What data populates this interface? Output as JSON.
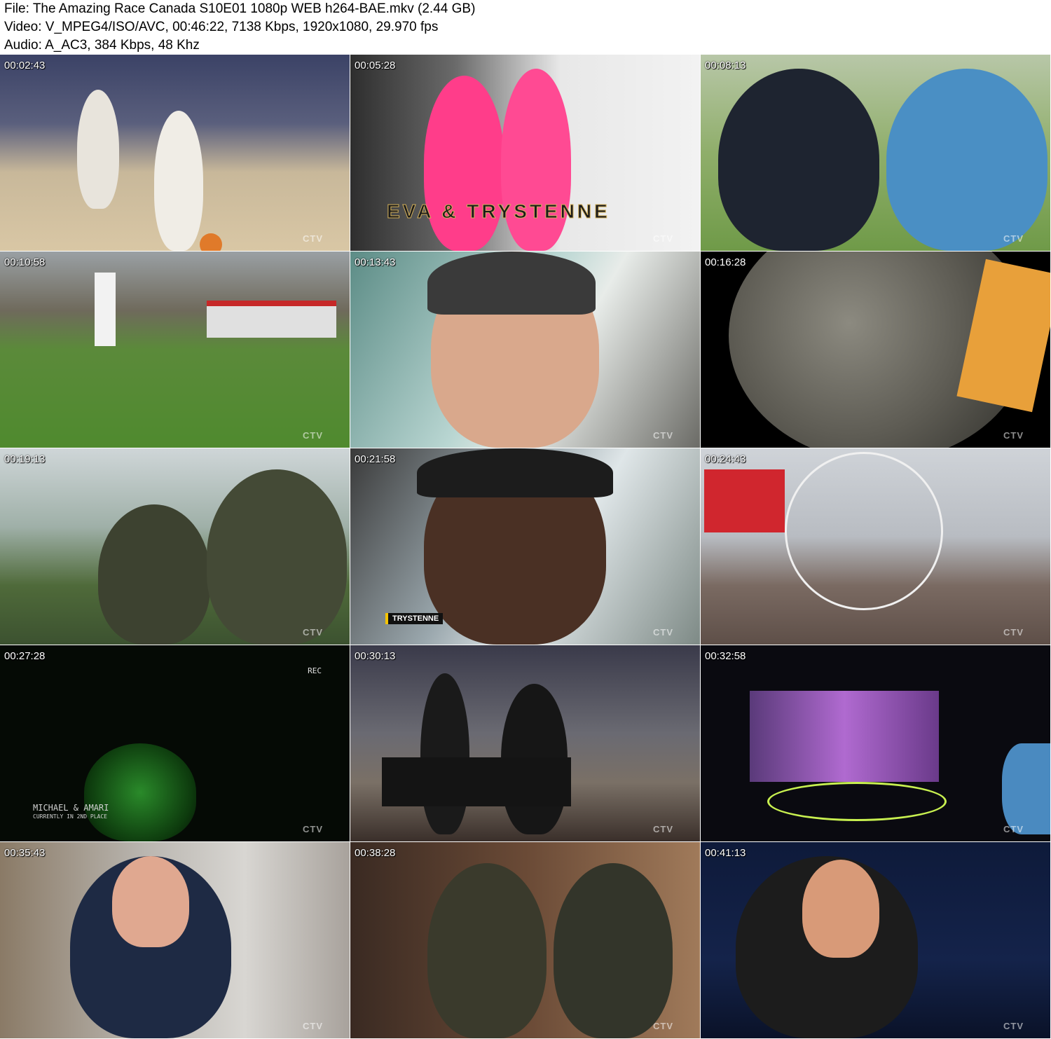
{
  "header": {
    "file": "File: The Amazing Race Canada S10E01 1080p WEB h264-BAE.mkv (2.44 GB)",
    "video": "Video: V_MPEG4/ISO/AVC, 00:46:22, 7138 Kbps, 1920x1080, 29.970 fps",
    "audio": "Audio: A_AC3, 384 Kbps, 48 Khz"
  },
  "thumbnails": [
    {
      "timestamp": "00:02:43",
      "watermark": "CTV"
    },
    {
      "timestamp": "00:05:28",
      "watermark": "CTV",
      "caption": "EVA & TRYSTENNE"
    },
    {
      "timestamp": "00:08:13",
      "watermark": "CTV"
    },
    {
      "timestamp": "00:10:58",
      "watermark": "CTV"
    },
    {
      "timestamp": "00:13:43",
      "watermark": "CTV"
    },
    {
      "timestamp": "00:16:28",
      "watermark": "CTV"
    },
    {
      "timestamp": "00:19:13",
      "watermark": "CTV"
    },
    {
      "timestamp": "00:21:58",
      "watermark": "CTV",
      "caption": "TRYSTENNE"
    },
    {
      "timestamp": "00:24:43",
      "watermark": "CTV"
    },
    {
      "timestamp": "00:27:28",
      "watermark": "CTV",
      "caption": "MICHAEL & AMARI",
      "subcaption": "CURRENTLY IN 2ND PLACE",
      "rec": "REC"
    },
    {
      "timestamp": "00:30:13",
      "watermark": "CTV"
    },
    {
      "timestamp": "00:32:58",
      "watermark": "CTV"
    },
    {
      "timestamp": "00:35:43",
      "watermark": "CTV"
    },
    {
      "timestamp": "00:38:28",
      "watermark": "CTV"
    },
    {
      "timestamp": "00:41:13",
      "watermark": "CTV"
    }
  ]
}
